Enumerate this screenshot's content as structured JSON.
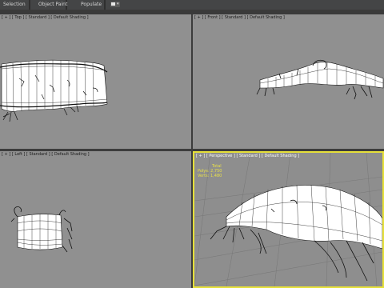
{
  "ribbon": {
    "tabs": [
      "Selection",
      "Object Paint",
      "Populate"
    ]
  },
  "viewports": {
    "top": {
      "label": "[ + ] [ Top ] [ Standard ] [ Default Shading ]"
    },
    "front": {
      "label": "[ + ] [ Front ] [ Standard ] [ Default Shading ]"
    },
    "left": {
      "label": "[ + ] [ Left ] [ Standard ] [ Default Shading ]"
    },
    "perspective": {
      "label": "[ + ] [ Perspective ] [ Standard ] [ Default Shading ]",
      "stats": {
        "title": "Total",
        "polys_label": "Polys:",
        "polys_value": "2,750",
        "verts_label": "Verts:",
        "verts_value": "1,480"
      }
    }
  },
  "colors": {
    "viewport_bg": "#909090",
    "active_border": "#e6e03a",
    "mesh_fill": "#ffffff",
    "mesh_wire": "#111111",
    "stats_text": "#e8e04a"
  }
}
